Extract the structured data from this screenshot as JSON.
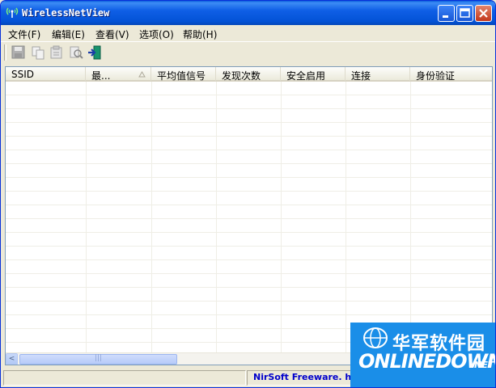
{
  "window": {
    "title": "WirelessNetView"
  },
  "menu": [
    "文件(F)",
    "编辑(E)",
    "查看(V)",
    "选项(O)",
    "帮助(H)"
  ],
  "toolbar": {
    "tools": [
      "save-icon",
      "copy-icon",
      "properties-icon",
      "find-icon",
      "exit-icon"
    ]
  },
  "list": {
    "columns": [
      "SSID",
      "最...",
      "平均值信号",
      "发现次数",
      "安全启用",
      "连接",
      "身份验证"
    ],
    "rows": []
  },
  "scrollbar": {
    "left_arrow": "<",
    "grip": "|||"
  },
  "status": {
    "link_text": "NirSoft Freeware.  http://www.nirsoft.net"
  },
  "watermark": {
    "cn": "华军软件园",
    "en": "ONLINEDOWN",
    "suffix": ".NET",
    "accent": "#1a8ee8"
  }
}
